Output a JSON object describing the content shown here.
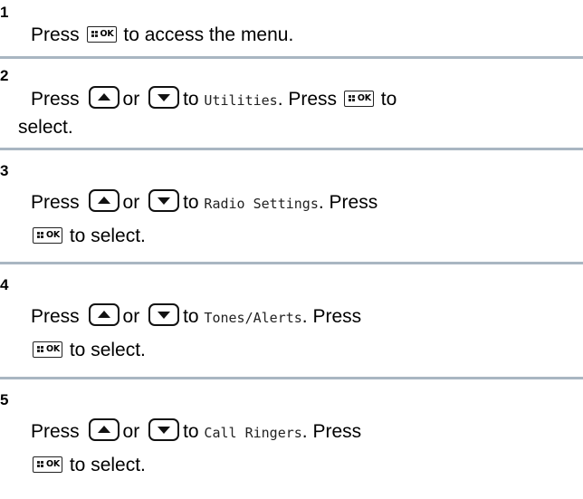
{
  "steps": [
    {
      "number": "1",
      "line1": {
        "press": "Press",
        "text": "to access the menu."
      }
    },
    {
      "number": "2",
      "press": "Press",
      "or": "or",
      "to": "to",
      "target": "Utilities",
      "after_target": ". Press",
      "to_end": "to",
      "line2": "select."
    },
    {
      "number": "3",
      "press": "Press",
      "or": "or",
      "to": "to",
      "target": "Radio Settings",
      "after_target": ". Press",
      "line2": "to select."
    },
    {
      "number": "4",
      "press": "Press",
      "or": "or",
      "to": "to",
      "target": "Tones/Alerts",
      "after_target": ". Press",
      "line2": "to select."
    },
    {
      "number": "5",
      "press": "Press",
      "or": "or",
      "to": "to",
      "target": "Call Ringers",
      "after_target": ". Press",
      "line2": "to select."
    }
  ],
  "icons": {
    "menu_ok_button": "menu-ok-button-icon",
    "up_button": "up-arrow-button-icon",
    "down_button": "down-arrow-button-icon"
  },
  "colors": {
    "divider": "#a9b6c2",
    "text": "#000000"
  },
  "ok_label": "OK"
}
